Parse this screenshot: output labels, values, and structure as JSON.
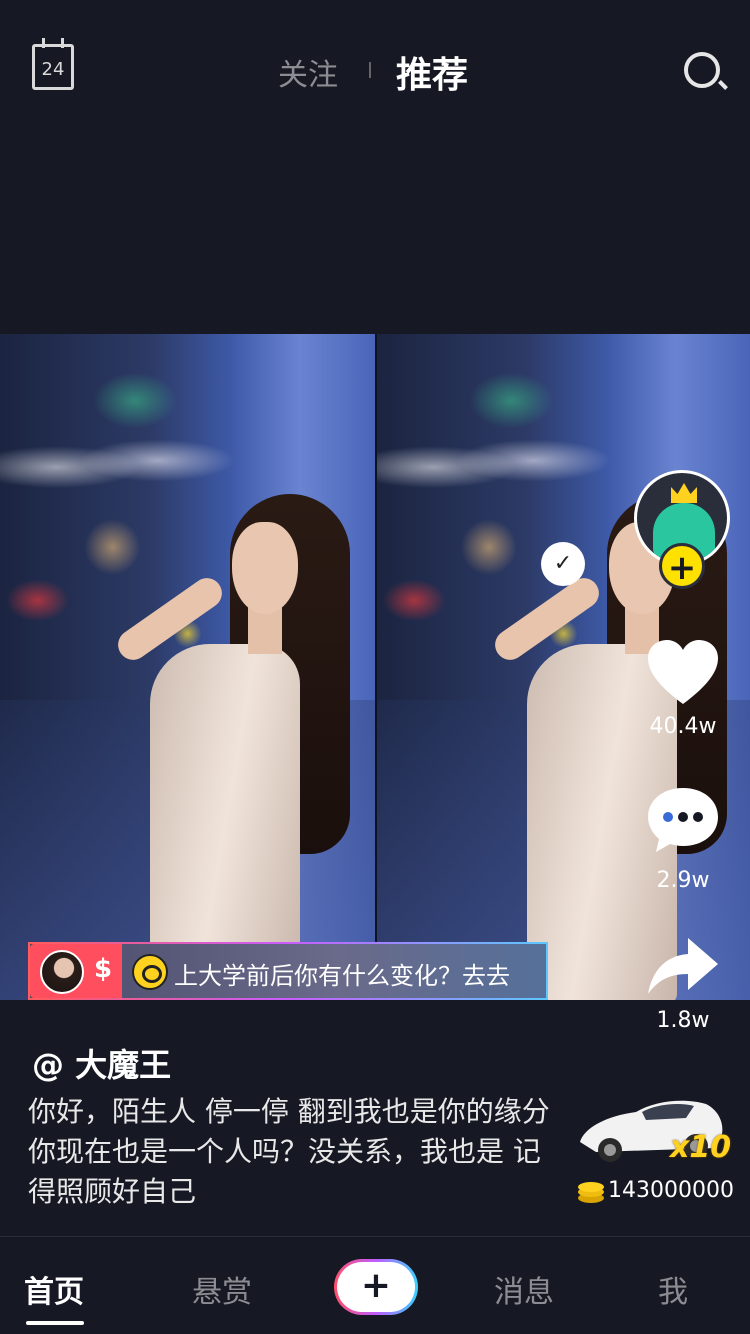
{
  "header": {
    "calendar_day": "24",
    "tabs": {
      "follow": "关注",
      "recommend": "推荐"
    }
  },
  "video": {
    "promo": {
      "dollar_sign": "$",
      "text": "上大学前后你有什么变化？去去"
    },
    "actions": {
      "follow_plus": "+",
      "likes": "40.4w",
      "comments": "2.9w",
      "shares": "1.8w"
    },
    "checkmark": "✓"
  },
  "info": {
    "author": "@ 大魔王",
    "caption": "你好，陌生人 停一停 翻到我也是你的缘分你现在也是一个人吗？没关系，我也是 记得照顾好自己",
    "gift": {
      "multiplier": "x10",
      "coins": "143000000"
    }
  },
  "nav": {
    "home": "首页",
    "bounty": "悬赏",
    "create": "+",
    "messages": "消息",
    "me": "我"
  },
  "colors": {
    "background": "#161823",
    "follow_accent": "#ffe100",
    "promo_red": "#ff4f5e"
  },
  "icons": [
    "calendar-icon",
    "search-icon",
    "check-icon",
    "coin-icon",
    "heart-icon",
    "comment-icon",
    "share-icon",
    "car-gift-icon",
    "coin-stack-icon"
  ]
}
